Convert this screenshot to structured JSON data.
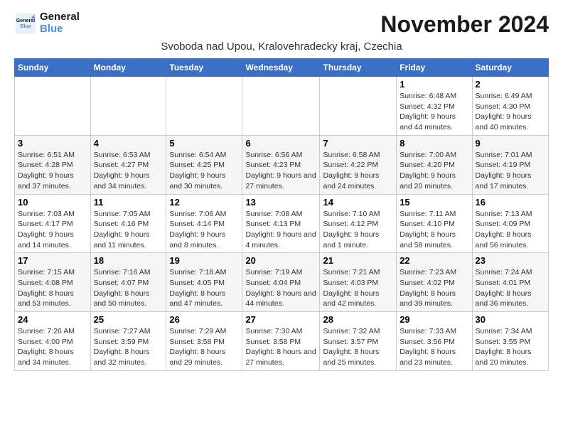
{
  "header": {
    "logo_line1": "General",
    "logo_line2": "Blue",
    "month_title": "November 2024",
    "location": "Svoboda nad Upou, Kralovehradecky kraj, Czechia"
  },
  "weekdays": [
    "Sunday",
    "Monday",
    "Tuesday",
    "Wednesday",
    "Thursday",
    "Friday",
    "Saturday"
  ],
  "weeks": [
    [
      {
        "day": "",
        "info": ""
      },
      {
        "day": "",
        "info": ""
      },
      {
        "day": "",
        "info": ""
      },
      {
        "day": "",
        "info": ""
      },
      {
        "day": "",
        "info": ""
      },
      {
        "day": "1",
        "info": "Sunrise: 6:48 AM\nSunset: 4:32 PM\nDaylight: 9 hours and 44 minutes."
      },
      {
        "day": "2",
        "info": "Sunrise: 6:49 AM\nSunset: 4:30 PM\nDaylight: 9 hours and 40 minutes."
      }
    ],
    [
      {
        "day": "3",
        "info": "Sunrise: 6:51 AM\nSunset: 4:28 PM\nDaylight: 9 hours and 37 minutes."
      },
      {
        "day": "4",
        "info": "Sunrise: 6:53 AM\nSunset: 4:27 PM\nDaylight: 9 hours and 34 minutes."
      },
      {
        "day": "5",
        "info": "Sunrise: 6:54 AM\nSunset: 4:25 PM\nDaylight: 9 hours and 30 minutes."
      },
      {
        "day": "6",
        "info": "Sunrise: 6:56 AM\nSunset: 4:23 PM\nDaylight: 9 hours and 27 minutes."
      },
      {
        "day": "7",
        "info": "Sunrise: 6:58 AM\nSunset: 4:22 PM\nDaylight: 9 hours and 24 minutes."
      },
      {
        "day": "8",
        "info": "Sunrise: 7:00 AM\nSunset: 4:20 PM\nDaylight: 9 hours and 20 minutes."
      },
      {
        "day": "9",
        "info": "Sunrise: 7:01 AM\nSunset: 4:19 PM\nDaylight: 9 hours and 17 minutes."
      }
    ],
    [
      {
        "day": "10",
        "info": "Sunrise: 7:03 AM\nSunset: 4:17 PM\nDaylight: 9 hours and 14 minutes."
      },
      {
        "day": "11",
        "info": "Sunrise: 7:05 AM\nSunset: 4:16 PM\nDaylight: 9 hours and 11 minutes."
      },
      {
        "day": "12",
        "info": "Sunrise: 7:06 AM\nSunset: 4:14 PM\nDaylight: 9 hours and 8 minutes."
      },
      {
        "day": "13",
        "info": "Sunrise: 7:08 AM\nSunset: 4:13 PM\nDaylight: 9 hours and 4 minutes."
      },
      {
        "day": "14",
        "info": "Sunrise: 7:10 AM\nSunset: 4:12 PM\nDaylight: 9 hours and 1 minute."
      },
      {
        "day": "15",
        "info": "Sunrise: 7:11 AM\nSunset: 4:10 PM\nDaylight: 8 hours and 58 minutes."
      },
      {
        "day": "16",
        "info": "Sunrise: 7:13 AM\nSunset: 4:09 PM\nDaylight: 8 hours and 56 minutes."
      }
    ],
    [
      {
        "day": "17",
        "info": "Sunrise: 7:15 AM\nSunset: 4:08 PM\nDaylight: 8 hours and 53 minutes."
      },
      {
        "day": "18",
        "info": "Sunrise: 7:16 AM\nSunset: 4:07 PM\nDaylight: 8 hours and 50 minutes."
      },
      {
        "day": "19",
        "info": "Sunrise: 7:18 AM\nSunset: 4:05 PM\nDaylight: 8 hours and 47 minutes."
      },
      {
        "day": "20",
        "info": "Sunrise: 7:19 AM\nSunset: 4:04 PM\nDaylight: 8 hours and 44 minutes."
      },
      {
        "day": "21",
        "info": "Sunrise: 7:21 AM\nSunset: 4:03 PM\nDaylight: 8 hours and 42 minutes."
      },
      {
        "day": "22",
        "info": "Sunrise: 7:23 AM\nSunset: 4:02 PM\nDaylight: 8 hours and 39 minutes."
      },
      {
        "day": "23",
        "info": "Sunrise: 7:24 AM\nSunset: 4:01 PM\nDaylight: 8 hours and 36 minutes."
      }
    ],
    [
      {
        "day": "24",
        "info": "Sunrise: 7:26 AM\nSunset: 4:00 PM\nDaylight: 8 hours and 34 minutes."
      },
      {
        "day": "25",
        "info": "Sunrise: 7:27 AM\nSunset: 3:59 PM\nDaylight: 8 hours and 32 minutes."
      },
      {
        "day": "26",
        "info": "Sunrise: 7:29 AM\nSunset: 3:58 PM\nDaylight: 8 hours and 29 minutes."
      },
      {
        "day": "27",
        "info": "Sunrise: 7:30 AM\nSunset: 3:58 PM\nDaylight: 8 hours and 27 minutes."
      },
      {
        "day": "28",
        "info": "Sunrise: 7:32 AM\nSunset: 3:57 PM\nDaylight: 8 hours and 25 minutes."
      },
      {
        "day": "29",
        "info": "Sunrise: 7:33 AM\nSunset: 3:56 PM\nDaylight: 8 hours and 23 minutes."
      },
      {
        "day": "30",
        "info": "Sunrise: 7:34 AM\nSunset: 3:55 PM\nDaylight: 8 hours and 20 minutes."
      }
    ]
  ]
}
